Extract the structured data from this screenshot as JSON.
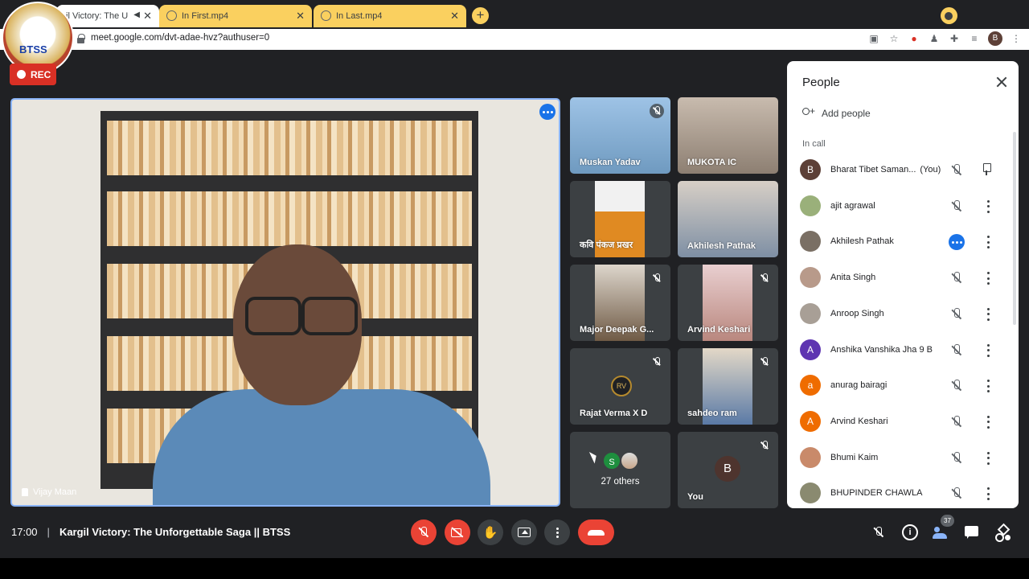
{
  "browser": {
    "tabs": [
      {
        "label": "il Victory: The U",
        "active": true
      },
      {
        "label": "In First.mp4",
        "active": false
      },
      {
        "label": "In Last.mp4",
        "active": false
      }
    ],
    "url": "meet.google.com/dvt-adae-hvz?authuser=0",
    "profile_initial": "B"
  },
  "overlay": {
    "logo_text": "BTSS",
    "rec_label": "REC"
  },
  "main_video": {
    "name": "Vijay Maan"
  },
  "tiles": [
    {
      "name": "Muskan Yadav",
      "muted": true,
      "bg": "#8fb4d6"
    },
    {
      "name": "MUKOTA IC",
      "muted": false,
      "bg": "#b7a99a"
    },
    {
      "name": "कवि पंकज प्रखर",
      "muted": false,
      "bg": "#d8892c"
    },
    {
      "name": "Akhilesh Pathak",
      "muted": false,
      "bg": "#9a8f86"
    },
    {
      "name": "Major Deepak G...",
      "muted": true,
      "bg": "#8b7a66"
    },
    {
      "name": "Arvind Keshari",
      "muted": true,
      "bg": "#c9a8a0"
    },
    {
      "name": "Rajat Verma X D",
      "muted": true,
      "avatar": "RV"
    },
    {
      "name": "sahdeo ram",
      "muted": true,
      "bg": "#7a8fa8"
    },
    {
      "name": "27 others",
      "muted": false,
      "avatar": "S"
    },
    {
      "name": "You",
      "muted": true,
      "avatar": "B"
    }
  ],
  "people_panel": {
    "title": "People",
    "add_people": "Add people",
    "section": "In call",
    "participants": [
      {
        "name": "Bharat Tibet Saman...",
        "suffix": "(You)",
        "avatar": "B",
        "color": "#5d4037",
        "action": "pin"
      },
      {
        "name": "ajit agrawal",
        "avatar": "",
        "color": "#9ab07a",
        "action": "more"
      },
      {
        "name": "Akhilesh Pathak",
        "avatar": "",
        "color": "#7a6f64",
        "action": "more",
        "speaking": true
      },
      {
        "name": "Anita Singh",
        "avatar": "",
        "color": "#b89a8a",
        "action": "more"
      },
      {
        "name": "Anroop Singh",
        "avatar": "",
        "color": "#a89f96",
        "action": "more"
      },
      {
        "name": "Anshika Vanshika Jha 9 B",
        "avatar": "A",
        "color": "#5e35b1",
        "action": "more"
      },
      {
        "name": "anurag bairagi",
        "avatar": "a",
        "color": "#ef6c00",
        "action": "more"
      },
      {
        "name": "Arvind Keshari",
        "avatar": "A",
        "color": "#ef6c00",
        "action": "more"
      },
      {
        "name": "Bhumi Kaim",
        "avatar": "",
        "color": "#c98a6a",
        "action": "more"
      },
      {
        "name": "BHUPINDER CHAWLA",
        "avatar": "",
        "color": "#8a8a70",
        "action": "more"
      }
    ]
  },
  "bottom_bar": {
    "time": "17:00",
    "separator": "|",
    "meeting_title": "Kargil Victory: The Unforgettable Saga || BTSS",
    "people_count": "37"
  }
}
